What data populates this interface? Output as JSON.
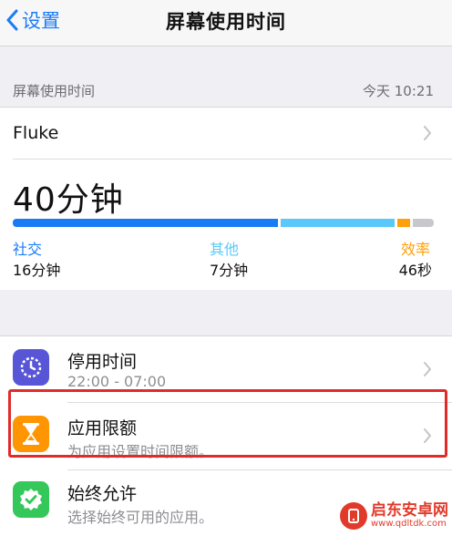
{
  "navbar": {
    "back_label": "设置",
    "title": "屏幕使用时间"
  },
  "header": {
    "label": "屏幕使用时间",
    "time": "今天 10:21"
  },
  "device": {
    "name": "Fluke"
  },
  "usage": {
    "total": "40分钟",
    "categories": [
      {
        "name": "社交",
        "value": "16分钟",
        "color": "#1a7cf5",
        "fraction": 0.63
      },
      {
        "name": "其他",
        "value": "7分钟",
        "color": "#5ac8fa",
        "fraction": 0.27
      },
      {
        "name": "效率",
        "value": "46秒",
        "color": "#ff9f0a",
        "fraction": 0.03
      }
    ],
    "remainder_color": "#c7c7cc"
  },
  "list": {
    "items": [
      {
        "title": "停用时间",
        "subtitle": "22:00 - 07:00",
        "icon": "downtime-icon",
        "color": "#5856d6"
      },
      {
        "title": "应用限额",
        "subtitle": "为应用设置时间限额。",
        "icon": "hourglass-icon",
        "color": "#ff9500"
      },
      {
        "title": "始终允许",
        "subtitle": "选择始终可用的应用。",
        "icon": "checkmark-badge-icon",
        "color": "#34c759"
      }
    ]
  },
  "highlight_color": "#e12a2a",
  "watermark": {
    "main": "启东安卓网",
    "url": "www.qdltdk.com"
  }
}
